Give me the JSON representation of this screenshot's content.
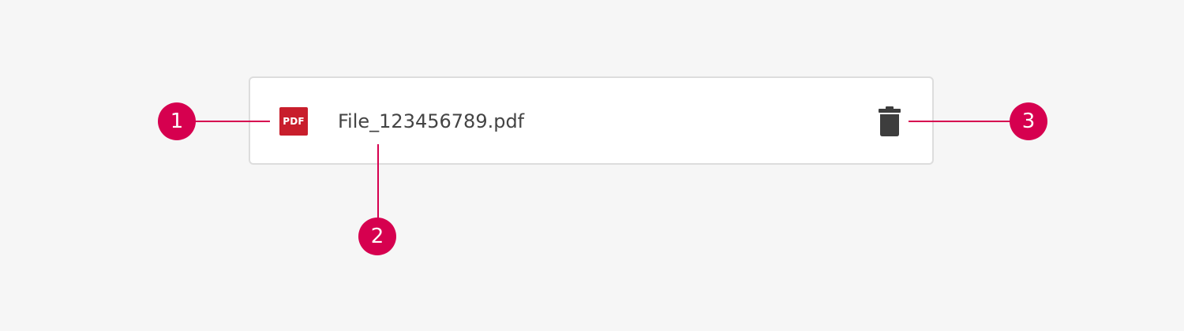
{
  "file_item": {
    "icon": "pdf-file-icon",
    "icon_label": "PDF",
    "icon_color": "#c81e2c",
    "file_name": "File_123456789.pdf",
    "delete_icon": "trash-icon"
  },
  "annotations": {
    "color": "#d6004f",
    "markers": [
      "1",
      "2",
      "3"
    ]
  }
}
